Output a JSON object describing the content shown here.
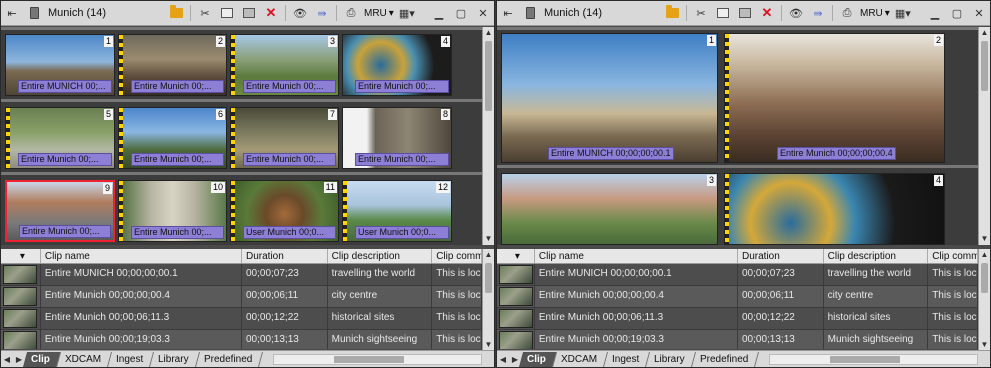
{
  "panes": [
    {
      "title": "Munich (14)",
      "mru": "MRU",
      "columns": [
        "Clip name",
        "Duration",
        "Clip description",
        "Clip comm"
      ],
      "rows": [
        [
          "Entire MUNICH 00;00;00;00.1",
          "00;00;07;23",
          "travelling the world",
          "This is local"
        ],
        [
          "Entire Munich 00;00;00;00.4",
          "00;00;06;11",
          "city centre",
          "This is local"
        ],
        [
          "Entire Munich 00;00;06;11.3",
          "00;00;12;22",
          "historical sites",
          "This is local"
        ],
        [
          "Entire Munich 00;00;19;03.3",
          "00;00;13;13",
          "Munich sightseeing",
          "This is local"
        ]
      ],
      "thumbs": [
        {
          "num": "1",
          "cap": "Entire MUNICH 00;..."
        },
        {
          "num": "2",
          "cap": "Entire Munich 00;..."
        },
        {
          "num": "3",
          "cap": "Entire Munich 00;..."
        },
        {
          "num": "4",
          "cap": "Entire Munich 00;..."
        },
        {
          "num": "5",
          "cap": "Entire Munich 00;..."
        },
        {
          "num": "6",
          "cap": "Entire Munich 00;..."
        },
        {
          "num": "7",
          "cap": "Entire Munich 00;..."
        },
        {
          "num": "8",
          "cap": "Entire Munich 00;..."
        },
        {
          "num": "9",
          "cap": "Entire Munich 00;..."
        },
        {
          "num": "10",
          "cap": "Entire Munich 00;..."
        },
        {
          "num": "11",
          "cap": "User Munich 00;0..."
        },
        {
          "num": "12",
          "cap": "User Munich 00;0..."
        }
      ]
    },
    {
      "title": "Munich (14)",
      "mru": "MRU",
      "columns": [
        "Clip name",
        "Duration",
        "Clip description",
        "Clip comm"
      ],
      "rows": [
        [
          "Entire MUNICH 00;00;00;00.1",
          "00;00;07;23",
          "travelling the world",
          "This is local"
        ],
        [
          "Entire Munich 00;00;00;00.4",
          "00;00;06;11",
          "city centre",
          "This is local"
        ],
        [
          "Entire Munich 00;00;06;11.3",
          "00;00;12;22",
          "historical sites",
          "This is local"
        ],
        [
          "Entire Munich 00;00;19;03.3",
          "00;00;13;13",
          "Munich sightseeing",
          "This is local"
        ]
      ],
      "thumbs": [
        {
          "num": "1",
          "cap": "Entire MUNICH 00;00;00;00.1"
        },
        {
          "num": "2",
          "cap": "Entire Munich 00;00;00;00.4"
        },
        {
          "num": "3",
          "cap": ""
        },
        {
          "num": "4",
          "cap": ""
        }
      ]
    }
  ],
  "tabs": [
    "Clip",
    "XDCAM",
    "Ingest",
    "Library",
    "Predefined"
  ],
  "icons": [
    "pin-icon",
    "bin-icon",
    "folder-up-icon",
    "cut-icon",
    "copy-icon",
    "paste-icon",
    "delete-icon",
    "eye-icon",
    "forward-icon",
    "print-icon",
    "mru-dropdown",
    "layout-icon",
    "minimize-icon",
    "maximize-icon",
    "close-icon"
  ]
}
